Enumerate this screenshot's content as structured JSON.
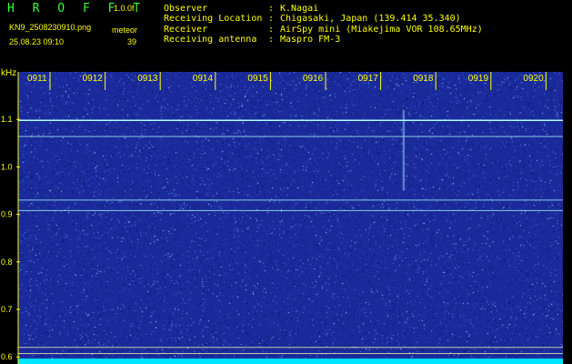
{
  "header": {
    "title": "H R O F F T",
    "version": "1.0.0f",
    "filename": "KN9_2508230910.png",
    "mode": "meteor",
    "timestamp": "25.08.23 09:10",
    "count": "39"
  },
  "station": [
    {
      "label": "Observer",
      "value": "K.Nagai"
    },
    {
      "label": "Receiving Location",
      "value": "Chigasaki, Japan (139.414 35.340)"
    },
    {
      "label": "Receiver",
      "value": "AirSpy mini (Miakejima VOR 108.65MHz)"
    },
    {
      "label": "Receiving antenna",
      "value": "Maspro FM-3"
    }
  ],
  "colors": {
    "text": "#ffff00",
    "title": "#33ff33",
    "background_noise": "#1a2a9a",
    "signal": "#b0ffff",
    "bottom_bar": "#00e5ff"
  },
  "chart_data": {
    "type": "heatmap",
    "ylabel": "kHz",
    "ytick_labels": [
      "1.1",
      "1.0",
      "0.9",
      "0.8",
      "0.7",
      "0.6"
    ],
    "yticks": [
      1.1,
      1.0,
      0.9,
      0.8,
      0.7,
      0.6
    ],
    "ylim": [
      0.585,
      1.2
    ],
    "xtick_labels": [
      "0911",
      "0912",
      "0913",
      "0914",
      "0915",
      "0916",
      "0917",
      "0918",
      "0919",
      "0920"
    ],
    "xlim": [
      "09:10",
      "09:20"
    ],
    "grid": false,
    "carriers_khz": [
      1.098,
      1.064,
      0.93,
      0.908,
      0.62,
      0.607
    ],
    "meteor_echo": {
      "time": "09:17.4",
      "khz_range": [
        0.95,
        1.12
      ]
    }
  }
}
